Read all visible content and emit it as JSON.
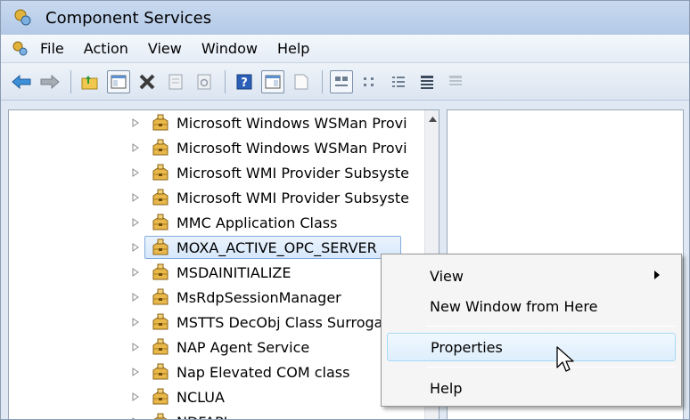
{
  "window": {
    "title": "Component Services"
  },
  "menubar": {
    "items": [
      "File",
      "Action",
      "View",
      "Window",
      "Help"
    ]
  },
  "toolbar": {
    "icons": [
      "back-arrow-icon",
      "forward-arrow-icon",
      "up-folder-icon",
      "show-hide-tree-icon",
      "delete-icon",
      "properties-icon",
      "refresh-icon",
      "help-icon",
      "show-hide-action-pane-icon",
      "new-window-icon",
      "large-icons-icon",
      "small-icons-icon",
      "list-view-icon",
      "detail-view-icon",
      "configure-icon"
    ]
  },
  "tree": {
    "items": [
      {
        "label": "Microsoft Windows WSMan Provi"
      },
      {
        "label": "Microsoft Windows WSMan Provi"
      },
      {
        "label": "Microsoft WMI Provider Subsyste"
      },
      {
        "label": "Microsoft WMI Provider Subsyste"
      },
      {
        "label": "MMC Application Class"
      },
      {
        "label": "MOXA_ACTIVE_OPC_SERVER",
        "selected": true
      },
      {
        "label": "MSDAINITIALIZE"
      },
      {
        "label": "MsRdpSessionManager"
      },
      {
        "label": "MSTTS DecObj Class Surrogate"
      },
      {
        "label": "NAP Agent Service"
      },
      {
        "label": "Nap Elevated COM class"
      },
      {
        "label": "NCLUA"
      },
      {
        "label": "NDFAPI"
      }
    ]
  },
  "context_menu": {
    "view": "View",
    "new_window": "New Window from Here",
    "properties": "Properties",
    "help": "Help"
  }
}
